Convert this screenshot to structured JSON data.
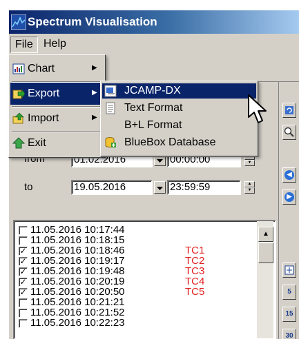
{
  "window": {
    "title": "Spectrum Visualisation"
  },
  "menubar": {
    "file": "File",
    "help": "Help"
  },
  "file_menu": {
    "items": [
      {
        "label": "Chart",
        "icon": "chart-icon",
        "has_submenu": true
      },
      {
        "label": "Export",
        "icon": "export-icon",
        "has_submenu": true,
        "selected": true
      },
      {
        "label": "Import",
        "icon": "import-icon",
        "has_submenu": true
      },
      {
        "label": "Exit",
        "icon": "exit-icon",
        "has_submenu": false
      }
    ]
  },
  "export_menu": {
    "items": [
      {
        "label": "JCAMP-DX",
        "icon": "jcamp-icon",
        "selected": true
      },
      {
        "label": "Text Format",
        "icon": "text-doc-icon"
      },
      {
        "label": "B+L Format",
        "icon": ""
      },
      {
        "label": "BlueBox Database",
        "icon": "database-add-icon"
      }
    ]
  },
  "date_range": {
    "from_label": "from",
    "from_date": "01.02.2016",
    "from_time": "00:00:00",
    "to_label": "to",
    "to_date": "19.05.2016",
    "to_time": "23:59:59"
  },
  "measurements": [
    {
      "timestamp": "11.05.2016 10:17:44",
      "checked": false,
      "tag": ""
    },
    {
      "timestamp": "11.05.2016 10:18:15",
      "checked": false,
      "tag": ""
    },
    {
      "timestamp": "11.05.2016 10:18:46",
      "checked": true,
      "tag": "TC1"
    },
    {
      "timestamp": "11.05.2016 10:19:17",
      "checked": true,
      "tag": "TC2"
    },
    {
      "timestamp": "11.05.2016 10:19:48",
      "checked": true,
      "tag": "TC3"
    },
    {
      "timestamp": "11.05.2016 10:20:19",
      "checked": true,
      "tag": "TC4"
    },
    {
      "timestamp": "11.05.2016 10:20:50",
      "checked": true,
      "tag": "TC5"
    },
    {
      "timestamp": "11.05.2016 10:21:21",
      "checked": false,
      "tag": ""
    },
    {
      "timestamp": "11.05.2016 10:21:52",
      "checked": false,
      "tag": ""
    },
    {
      "timestamp": "11.05.2016 10:22:23",
      "checked": false,
      "tag": ""
    }
  ],
  "toolbar": {
    "buttons": [
      "refresh-icon",
      "zoom-icon",
      "arrow-left-icon",
      "arrow-right-icon",
      "interval-icon",
      "5-icon",
      "15-icon",
      "30-icon"
    ],
    "labels": {
      "five": "5",
      "fifteen": "15",
      "thirty": "30"
    }
  },
  "colors": {
    "tag": "#e02020",
    "selection": "#0a246a",
    "face": "#d4d0c8"
  }
}
